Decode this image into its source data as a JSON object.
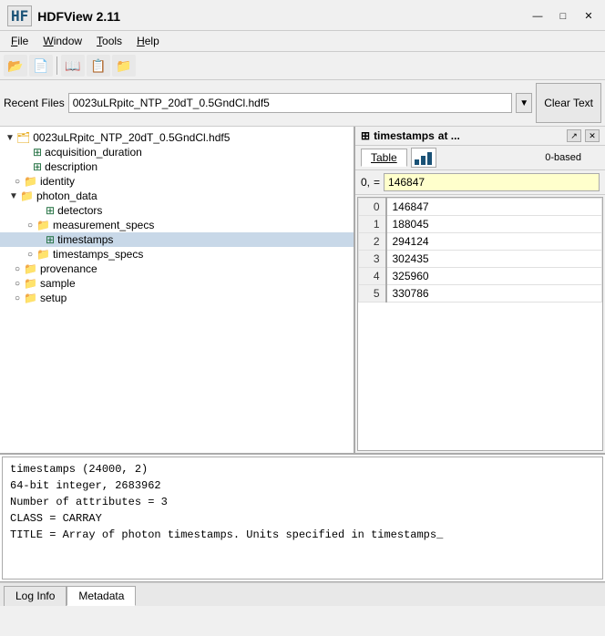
{
  "titlebar": {
    "icon": "HF",
    "title": "HDFView 2.11",
    "minimize": "—",
    "maximize": "□",
    "close": "✕"
  },
  "menubar": {
    "items": [
      "File",
      "Window",
      "Tools",
      "Help"
    ]
  },
  "toolbar": {
    "buttons": [
      "open-folder",
      "open-file",
      "book",
      "copy",
      "paste"
    ]
  },
  "recent_files": {
    "label": "Recent Files",
    "value": "0023uLRpitc_NTP_20dT_0.5GndCl.hdf5",
    "clear_button": "Clear Text"
  },
  "tree": {
    "root": {
      "label": "0023uLRpitc_NTP_20dT_0.5GndCl.hdf5",
      "children": [
        {
          "label": "acquisition_duration",
          "type": "dataset",
          "indent": 1
        },
        {
          "label": "description",
          "type": "dataset",
          "indent": 1
        },
        {
          "label": "identity",
          "type": "group",
          "indent": 1,
          "expanded": false
        },
        {
          "label": "photon_data",
          "type": "group",
          "indent": 1,
          "expanded": true,
          "children": [
            {
              "label": "detectors",
              "type": "dataset",
              "indent": 2
            },
            {
              "label": "measurement_specs",
              "type": "group",
              "indent": 2
            },
            {
              "label": "timestamps",
              "type": "dataset",
              "indent": 2,
              "selected": true
            },
            {
              "label": "timestamps_specs",
              "type": "group",
              "indent": 2
            }
          ]
        },
        {
          "label": "provenance",
          "type": "group",
          "indent": 1,
          "expanded": false
        },
        {
          "label": "sample",
          "type": "group",
          "indent": 1,
          "expanded": false
        },
        {
          "label": "setup",
          "type": "group",
          "indent": 1,
          "expanded": false
        }
      ]
    }
  },
  "data_panel": {
    "title": "timestamps",
    "subtitle": "at ...",
    "tabs": [
      "Table"
    ],
    "zero_based": "0-based",
    "index_label": "0,",
    "index_eq": "=",
    "index_value": "146847",
    "rows": [
      {
        "index": "0",
        "value": "146847"
      },
      {
        "index": "1",
        "value": "188045"
      },
      {
        "index": "2",
        "value": "294124"
      },
      {
        "index": "3",
        "value": "302435"
      },
      {
        "index": "4",
        "value": "325960"
      },
      {
        "index": "5",
        "value": "330786"
      }
    ]
  },
  "info_panel": {
    "lines": [
      "timestamps (24000, 2)",
      "  64-bit integer,   2683962",
      "  Number of attributes = 3",
      "    CLASS = CARRAY",
      "    TITLE = Array of photon timestamps. Units specified in timestamps_"
    ]
  },
  "bottom_tabs": {
    "items": [
      "Log Info",
      "Metadata"
    ],
    "active": "Metadata"
  }
}
